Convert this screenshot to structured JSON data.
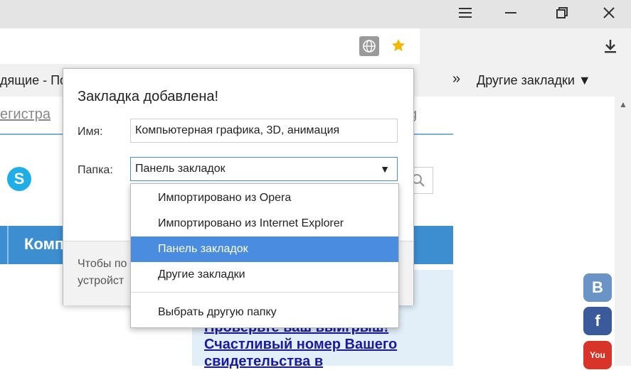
{
  "window": {
    "menu_icon": "hamburger-icon",
    "minimize_icon": "minimize-icon",
    "maximize_icon": "restore-icon",
    "close_icon": "close-icon"
  },
  "toolbar": {
    "globe_icon": "globe-icon",
    "star_icon": "star-icon",
    "download_icon": "download-icon"
  },
  "bookmarks_bar": {
    "left_fragment": "дящие - По",
    "chevron": "»",
    "other_bookmarks": "Другие закладки ▼"
  },
  "page": {
    "link_fragment": "егистра",
    "link_right_fragment": "g",
    "nav_fragment": "Комп",
    "promo_line1": "Проверьте ваш выигрыш!",
    "promo_line2": "Счастливый номер Вашего",
    "promo_line3": "свидетельства в",
    "social": [
      "В",
      "f",
      "You"
    ]
  },
  "popup": {
    "title": "Закладка добавлена!",
    "name_label": "Имя:",
    "name_value": "Компьютерная графика, 3D, анимация",
    "folder_label": "Папка:",
    "folder_value": "Панель закладок",
    "footer_line1": "Чтобы по",
    "footer_line2": "устройст"
  },
  "dropdown": {
    "items": [
      "Импортировано из Opera",
      "Импортировано из Internet Explorer",
      "Панель закладок",
      "Другие закладки"
    ],
    "selected_index": 2,
    "choose_other": "Выбрать другую папку"
  },
  "colors": {
    "accent": "#4a8de0",
    "star": "#f5b800",
    "nav_blue": "#3d8ed1"
  }
}
